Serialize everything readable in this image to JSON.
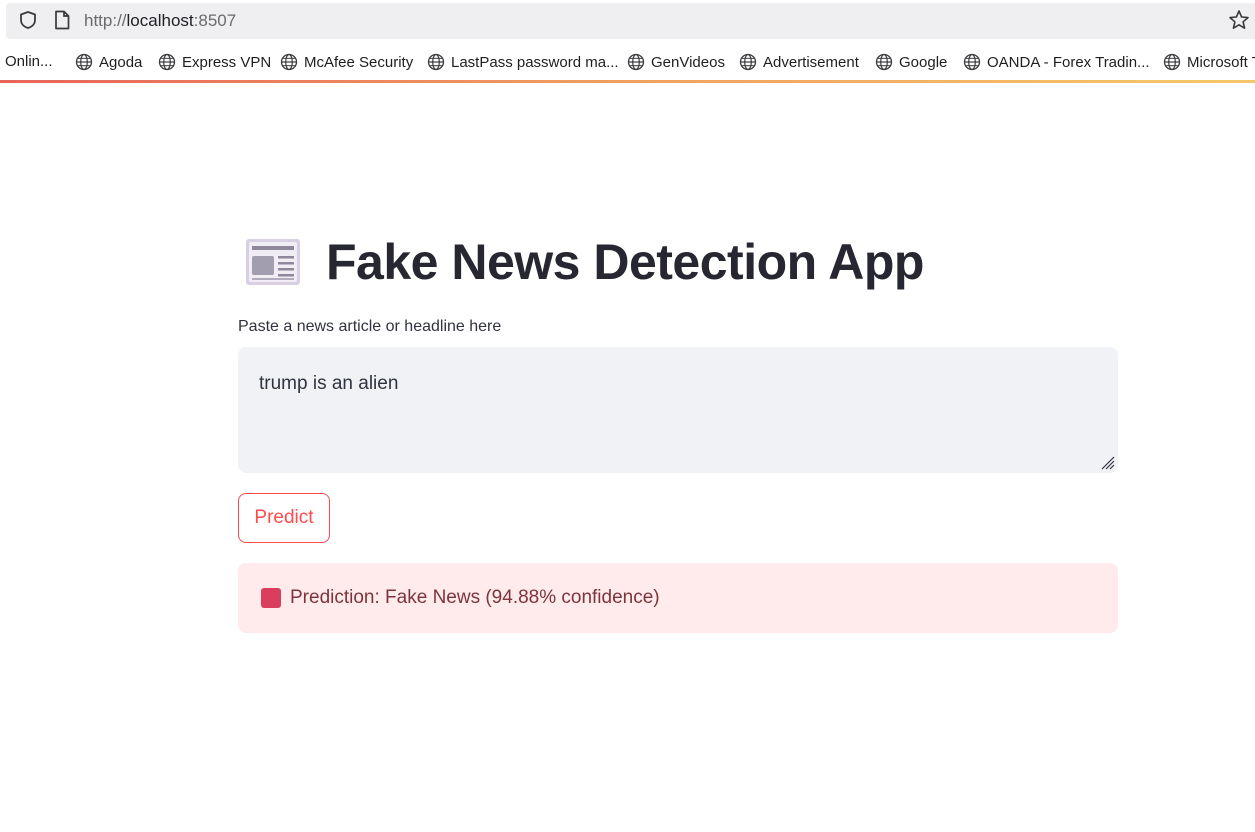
{
  "browser": {
    "url_scheme": "http://",
    "url_host": "localhost",
    "url_port": ":8507"
  },
  "bookmarks": [
    {
      "label": "Onlin..."
    },
    {
      "label": "Agoda"
    },
    {
      "label": "Express VPN"
    },
    {
      "label": "McAfee Security"
    },
    {
      "label": "LastPass password ma..."
    },
    {
      "label": "GenVideos"
    },
    {
      "label": "Advertisement"
    },
    {
      "label": "Google"
    },
    {
      "label": "OANDA - Forex Tradin..."
    },
    {
      "label": "Microsoft T"
    }
  ],
  "app": {
    "title": "Fake News Detection App",
    "input_label": "Paste a news article or headline here",
    "input_value": "trump is an alien",
    "predict_label": "Predict",
    "result_text": "Prediction: Fake News (94.88% confidence)"
  },
  "colors": {
    "accent": "#ff4b4b",
    "alert_bg": "#ffebec",
    "alert_text": "#7d353b",
    "alert_square": "#d93f5c"
  },
  "icons": {
    "title_icon": "newspaper-icon",
    "result_icon": "red-square-icon"
  }
}
